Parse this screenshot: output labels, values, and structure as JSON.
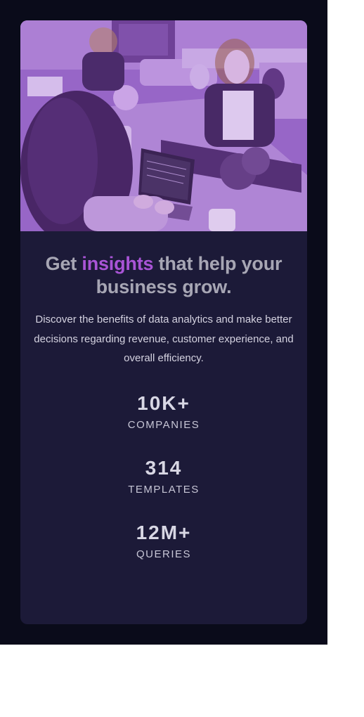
{
  "colors": {
    "page_background": "#0a0b1a",
    "card_background": "#1c1a38",
    "accent": "#a954d6",
    "heading": "#a7a6b4",
    "body_text": "#d4d2e0",
    "image_tint": "#8a5cb8"
  },
  "hero_image": {
    "icon": "office-team-photo-purple-tint"
  },
  "headline": {
    "before": "Get ",
    "accent": "insights",
    "after": " that help your business grow."
  },
  "description": "Discover the benefits of data analytics and make better decisions regarding revenue, customer experience, and overall efficiency.",
  "stats": [
    {
      "value": "10K+",
      "label": "COMPANIES"
    },
    {
      "value": "314",
      "label": "TEMPLATES"
    },
    {
      "value": "12M+",
      "label": "QUERIES"
    }
  ]
}
